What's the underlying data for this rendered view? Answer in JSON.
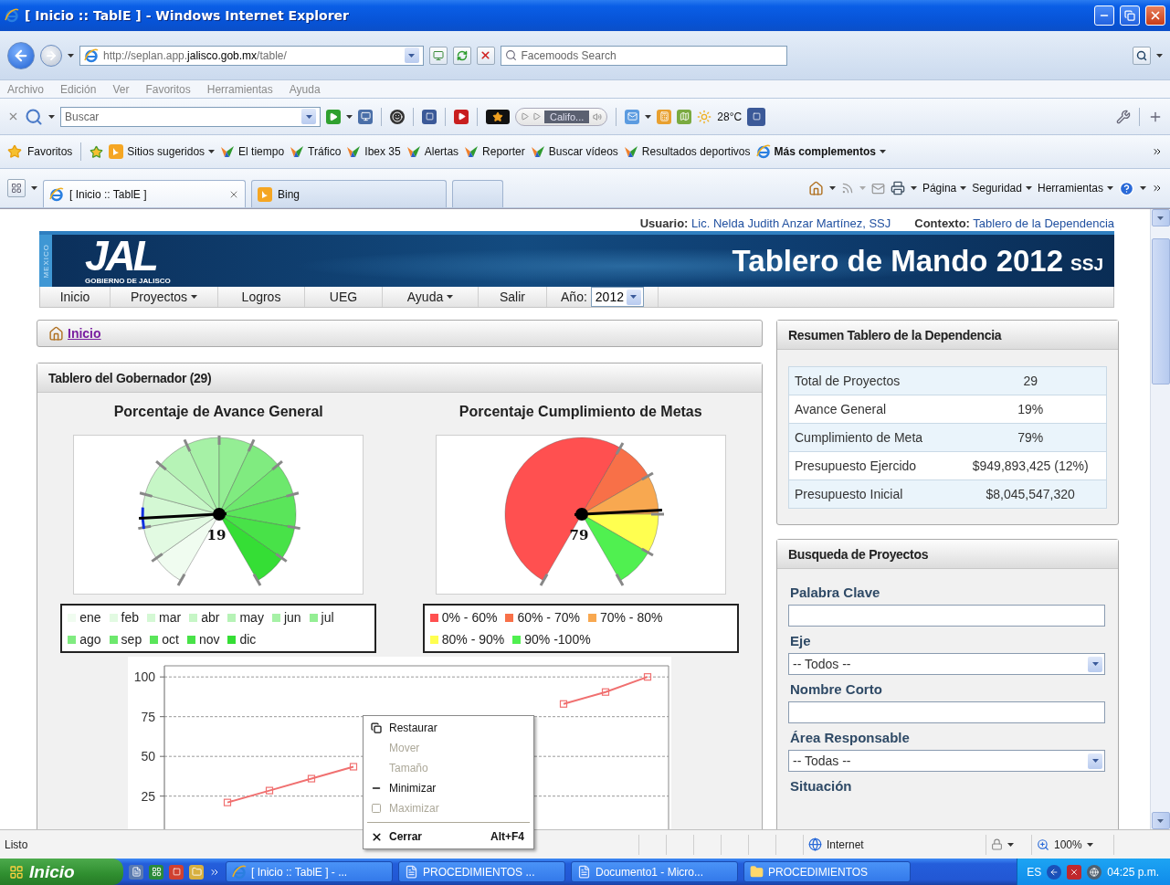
{
  "window": {
    "title": "[ Inicio :: TablE ] - Windows Internet Explorer"
  },
  "address_bar": {
    "url": "http://seplan.app.**jalisco.gob.mx**/table/",
    "search_placeholder": "Facemoods Search"
  },
  "menu_bar": [
    "Archivo",
    "Edición",
    "Ver",
    "Favoritos",
    "Herramientas",
    "Ayuda"
  ],
  "toolbar": {
    "search_placeholder": "Buscar",
    "radio_station": "Califo...",
    "temperature": "28°C"
  },
  "favorites_bar": {
    "label": "Favoritos",
    "links": [
      {
        "label": "Sitios sugeridos",
        "kind": "bing",
        "dropdown": true
      },
      {
        "label": "El tiempo",
        "kind": "feed",
        "dropdown": false
      },
      {
        "label": "Tráfico",
        "kind": "feed",
        "dropdown": false
      },
      {
        "label": "Ibex 35",
        "kind": "feed",
        "dropdown": false
      },
      {
        "label": "Alertas",
        "kind": "feed",
        "dropdown": false
      },
      {
        "label": "Reporter",
        "kind": "feed",
        "dropdown": false
      },
      {
        "label": "Buscar vídeos",
        "kind": "feed",
        "dropdown": false
      },
      {
        "label": "Resultados deportivos",
        "kind": "feed",
        "dropdown": false
      },
      {
        "label": "Más complementos",
        "kind": "ie",
        "dropdown": true
      }
    ]
  },
  "tabs": [
    {
      "label": "[ Inicio :: TablE ]",
      "kind": "ie",
      "selected": true
    },
    {
      "label": "Bing",
      "kind": "bing",
      "selected": false
    }
  ],
  "command_bar": [
    "Página",
    "Seguridad",
    "Herramientas"
  ],
  "page": {
    "user": "**Usuario:** Lic. Nelda Judith Anzar Martínez, SSJ",
    "context": "**Contexto:** Tablero de la Dependencia",
    "banner": {
      "side_text": "MEXICO",
      "logo": "JAL",
      "logo_caption": "GOBIERNO DE JALISCO",
      "title": "Tablero de Mando 2012",
      "suffix": "SSJ"
    },
    "nav": {
      "items": [
        {
          "label": "Inicio",
          "dropdown": false
        },
        {
          "label": "Proyectos",
          "dropdown": true
        },
        {
          "label": "Logros",
          "dropdown": false
        },
        {
          "label": "UEG",
          "dropdown": false
        },
        {
          "label": "Ayuda",
          "dropdown": true
        },
        {
          "label": "Salir",
          "dropdown": false
        }
      ],
      "year_label": "Año:",
      "year": "2012"
    },
    "breadcrumb": "Inicio",
    "governor_panel": {
      "title": "Tablero del Gobernador (29)",
      "gauges": [
        {
          "title": "Porcentaje de Avance General",
          "kind": "monthly",
          "value": "19",
          "legend": [
            {
              "label": "ene",
              "color": "#f0fcf0"
            },
            {
              "label": "feb",
              "color": "#e2fae2"
            },
            {
              "label": "mar",
              "color": "#d4f8d4"
            },
            {
              "label": "abr",
              "color": "#c6f6c6"
            },
            {
              "label": "may",
              "color": "#b6f3b6"
            },
            {
              "label": "jun",
              "color": "#a6f1a6"
            },
            {
              "label": "jul",
              "color": "#94ee94"
            },
            {
              "label": "ago",
              "color": "#80eb80"
            },
            {
              "label": "sep",
              "color": "#6de86d"
            },
            {
              "label": "oct",
              "color": "#5ae55a"
            },
            {
              "label": "nov",
              "color": "#48e248"
            },
            {
              "label": "dic",
              "color": "#35de35"
            }
          ]
        },
        {
          "title": "Porcentaje Cumplimiento de Metas",
          "kind": "threshold",
          "value": "79",
          "legend": [
            {
              "label": "0% - 60%",
              "color": "#ff5050"
            },
            {
              "label": "60% - 70%",
              "color": "#f87048"
            },
            {
              "label": "70% - 80%",
              "color": "#f8a850"
            },
            {
              "label": "80% - 90%",
              "color": "#ffff50"
            },
            {
              "label": "90% -100%",
              "color": "#50f050"
            }
          ]
        }
      ],
      "line_chart": {
        "chart_data": {
          "type": "line",
          "ylim": [
            0,
            107
          ],
          "yticks": [
            25,
            50,
            75,
            100
          ],
          "grid": true,
          "series": [
            {
              "color": "#f07070",
              "marker": "square",
              "values": [
                null,
                21,
                28.5,
                36,
                43.5,
                null,
                null,
                null,
                null,
                83,
                90.5,
                100
              ]
            }
          ]
        }
      }
    },
    "summary": {
      "title": "Resumen Tablero de la Dependencia",
      "rows": [
        {
          "label": "Total de Proyectos",
          "value": "29"
        },
        {
          "label": "Avance General",
          "value": "19%"
        },
        {
          "label": "Cumplimiento de Meta",
          "value": "79%"
        },
        {
          "label": "Presupuesto Ejercido",
          "value": "$949,893,425 (12%)"
        },
        {
          "label": "Presupuesto Inicial",
          "value": "$8,045,547,320"
        }
      ]
    },
    "search": {
      "title": "Busqueda de Proyectos",
      "fields": [
        {
          "label": "Palabra Clave",
          "kind": "text"
        },
        {
          "label": "Eje",
          "kind": "select",
          "value": "-- Todos --"
        },
        {
          "label": "Nombre Corto",
          "kind": "text"
        },
        {
          "label": "Área Responsable",
          "kind": "select",
          "value": "-- Todas --"
        },
        {
          "label": "Situación",
          "kind": "label"
        }
      ]
    }
  },
  "status_bar": {
    "text": "Listo",
    "zone": "Internet",
    "zoom": "100%"
  },
  "taskbar": {
    "start": "Inicio",
    "tasks": [
      {
        "label": "[ Inicio :: TablE ] - ...",
        "kind": "ie"
      },
      {
        "label": "PROCEDIMIENTOS ...",
        "kind": "word"
      },
      {
        "label": "Documento1 - Micro...",
        "kind": "word"
      },
      {
        "label": "PROCEDIMIENTOS",
        "kind": "folder"
      }
    ],
    "language": "ES",
    "clock": "04:25 p.m."
  },
  "context_menu": {
    "items": [
      {
        "label": "Restaurar",
        "kind": "restore",
        "disabled": false
      },
      {
        "label": "Mover",
        "kind": "plain",
        "disabled": true
      },
      {
        "label": "Tamaño",
        "kind": "plain",
        "disabled": true
      },
      {
        "label": "Minimizar",
        "kind": "minimize",
        "disabled": false
      },
      {
        "label": "Maximizar",
        "kind": "maximize",
        "disabled": true
      },
      {
        "label": "Cerrar",
        "kind": "close",
        "disabled": false,
        "shortcut": "Alt+F4"
      }
    ]
  }
}
